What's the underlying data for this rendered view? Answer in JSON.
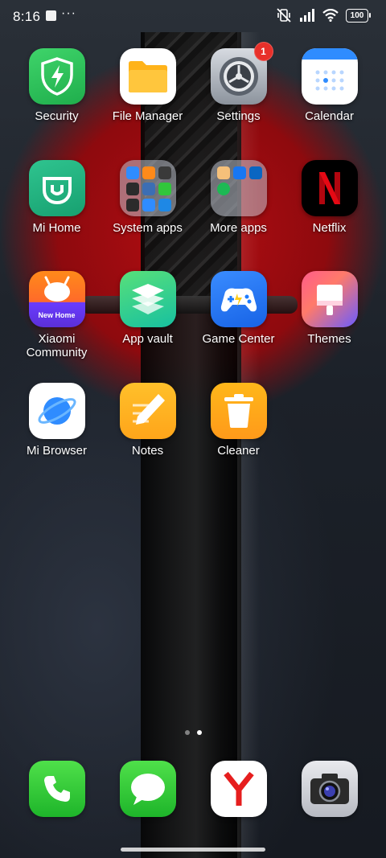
{
  "status_bar": {
    "time": "8:16",
    "dots": "···",
    "battery": "100"
  },
  "apps": [
    {
      "label": "Security",
      "icon": "shield-bolt-icon",
      "color": "#2cc35b"
    },
    {
      "label": "File Manager",
      "icon": "folder-icon",
      "color": "#ffb31a"
    },
    {
      "label": "Settings",
      "icon": "gear-icon",
      "color": "#9aa1ab",
      "badge": "1"
    },
    {
      "label": "Calendar",
      "icon": "calendar-icon",
      "color": "#2f8cff"
    },
    {
      "label": "Mi Home",
      "icon": "mi-home-icon",
      "color": "#21b07e"
    },
    {
      "label": "System apps",
      "icon": "folder-icon"
    },
    {
      "label": "More apps",
      "icon": "folder-icon"
    },
    {
      "label": "Netflix",
      "icon": "netflix-icon",
      "color": "#e50914"
    },
    {
      "label": "Xiaomi Community",
      "icon": "community-icon",
      "color": "#ff7a1a",
      "sublabel": "New Home"
    },
    {
      "label": "App vault",
      "icon": "layers-icon",
      "color": "#2ed28a"
    },
    {
      "label": "Game Center",
      "icon": "gamepad-icon",
      "color": "#1d7cff"
    },
    {
      "label": "Themes",
      "icon": "paint-brush-icon",
      "color": "#ff5c8a"
    },
    {
      "label": "Mi Browser",
      "icon": "browser-planet-icon",
      "color": "#2f8cff"
    },
    {
      "label": "Notes",
      "icon": "pencil-icon",
      "color": "#ffb21a"
    },
    {
      "label": "Cleaner",
      "icon": "trash-icon",
      "color": "#ffa11a"
    }
  ],
  "dock": [
    {
      "label": "Phone",
      "icon": "phone-icon",
      "color": "#31c63b"
    },
    {
      "label": "Messages",
      "icon": "message-icon",
      "color": "#31c63b"
    },
    {
      "label": "Yandex",
      "icon": "yandex-icon",
      "color": "#e61e1e"
    },
    {
      "label": "Camera",
      "icon": "camera-icon",
      "color": "#2b2b2b"
    }
  ],
  "page_indicator": {
    "pages": 2,
    "current": 2
  }
}
